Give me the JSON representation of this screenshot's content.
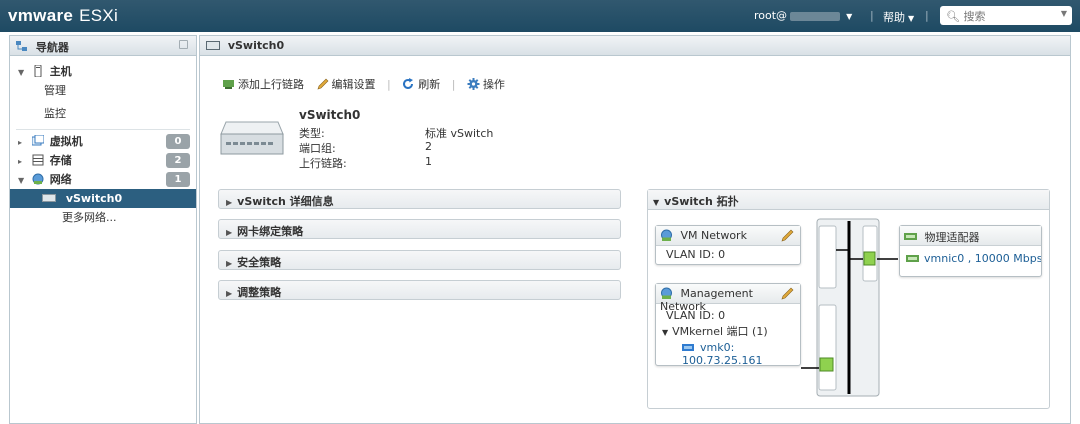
{
  "topbar": {
    "brand_vm": "vmware",
    "brand_esxi": "ESXi",
    "user": "root@",
    "help": "帮助",
    "search_placeholder": "搜索"
  },
  "navigator": {
    "title": "导航器",
    "host": {
      "label": "主机",
      "children": [
        "管理",
        "监控"
      ]
    },
    "vms": {
      "label": "虚拟机",
      "count": "0"
    },
    "storage": {
      "label": "存储",
      "count": "2"
    },
    "network": {
      "label": "网络",
      "count": "1"
    },
    "network_children": [
      "vSwitch0",
      "更多网络..."
    ]
  },
  "main": {
    "tab_title": "vSwitch0",
    "toolbar": {
      "add_uplink": "添加上行链路",
      "edit_settings": "编辑设置",
      "refresh": "刷新",
      "actions": "操作"
    },
    "summary": {
      "name": "vSwitch0",
      "rows": [
        {
          "label": "类型:",
          "value": "标准 vSwitch"
        },
        {
          "label": "端口组:",
          "value": "2"
        },
        {
          "label": "上行链路:",
          "value": "1"
        }
      ]
    },
    "sections": [
      "vSwitch 详细信息",
      "网卡绑定策略",
      "安全策略",
      "调整策略"
    ],
    "topology": {
      "title": "vSwitch 拓扑",
      "portgroups": [
        {
          "name": "VM Network",
          "vlan": "VLAN ID: 0"
        },
        {
          "name": "Management Network",
          "vlan": "VLAN ID: 0",
          "vmkernel_label": "VMkernel 端口 (1)",
          "vmk": "vmk0: 100.73.25.161"
        }
      ],
      "physical": {
        "title": "物理适配器",
        "nic": "vmnic0 , 10000 Mbps, ..."
      }
    }
  },
  "colors": {
    "topbar": "#1e4a63",
    "selected": "#2c5f80",
    "link": "#1d5f96",
    "port_green": "#8fd14f"
  }
}
